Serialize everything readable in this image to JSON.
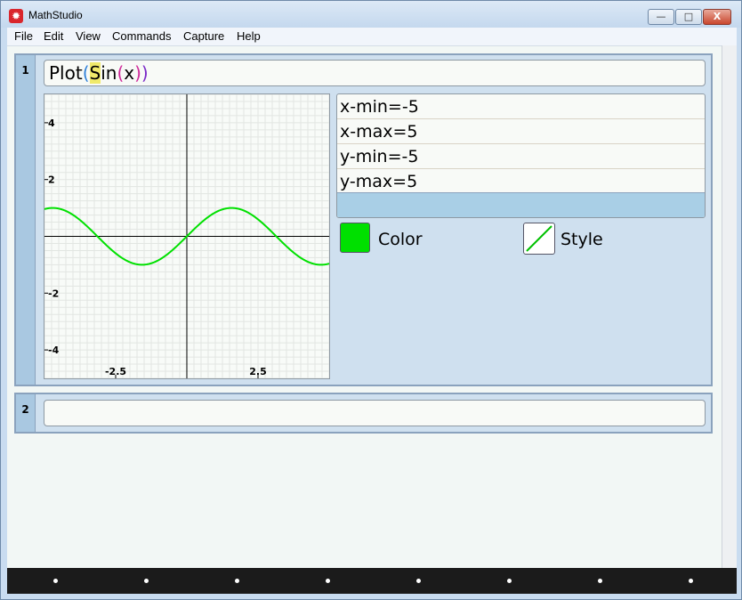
{
  "app": {
    "title": "MathStudio"
  },
  "window_buttons": {
    "minimize": "—",
    "maximize": "□",
    "close": "X"
  },
  "menu": [
    "File",
    "Edit",
    "View",
    "Commands",
    "Capture",
    "Help"
  ],
  "cells": [
    {
      "number": "1",
      "formula": {
        "plot": "Plot",
        "lparen": "(",
        "s": "S",
        "in": "in",
        "lparen2": "(",
        "x": "x",
        "rparen2": ")",
        "rparen": ")"
      },
      "params": {
        "x_min": "x-min=-5",
        "x_max": "x-max=5",
        "y_min": "y-min=-5",
        "y_max": "y-max=5"
      },
      "color_label": "Color",
      "style_label": "Style",
      "plot_color": "#00e000"
    },
    {
      "number": "2",
      "formula": ""
    }
  ],
  "chart_data": {
    "type": "line",
    "series": [
      {
        "function": "sin(x)",
        "color": "#00e000"
      }
    ],
    "xlim": [
      -5,
      5
    ],
    "ylim": [
      -5,
      5
    ],
    "x_ticks": [
      "-2.5",
      "2.5"
    ],
    "y_ticks": [
      "4",
      "2",
      "-2",
      "-4"
    ],
    "grid": true
  },
  "statusbar": {
    "dots": 8
  }
}
